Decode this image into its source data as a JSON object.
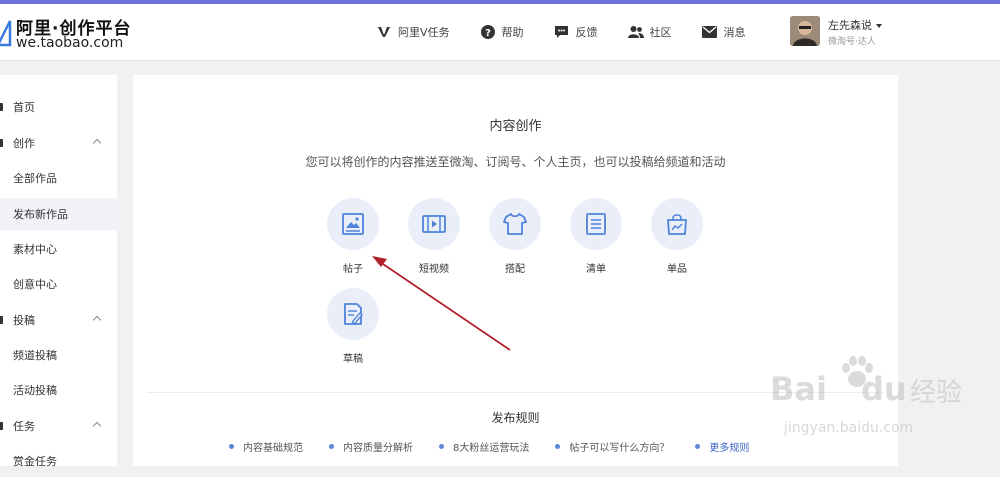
{
  "header": {
    "logo_title": "阿里·创作平台",
    "logo_subtitle": "we.taobao.com",
    "nav": [
      {
        "label": "阿里V任务",
        "icon": "v-icon"
      },
      {
        "label": "帮助",
        "icon": "help-icon"
      },
      {
        "label": "反馈",
        "icon": "feedback-icon"
      },
      {
        "label": "社区",
        "icon": "community-icon"
      },
      {
        "label": "消息",
        "icon": "mail-icon"
      }
    ],
    "user": {
      "name": "左先森说",
      "role": "微淘号·达人"
    }
  },
  "sidebar": {
    "items": [
      {
        "label": "首页"
      },
      {
        "label": "创作"
      },
      {
        "label": "全部作品"
      },
      {
        "label": "发布新作品"
      },
      {
        "label": "素材中心"
      },
      {
        "label": "创意中心"
      },
      {
        "label": "投稿"
      },
      {
        "label": "频道投稿"
      },
      {
        "label": "活动投稿"
      },
      {
        "label": "任务"
      },
      {
        "label": "赏金任务"
      }
    ]
  },
  "main": {
    "title": "内容创作",
    "description": "您可以将创作的内容推送至微淘、订阅号、个人主页，也可以投稿给频道和活动",
    "tiles": [
      {
        "label": "帖子",
        "icon": "post-image-icon"
      },
      {
        "label": "短视频",
        "icon": "video-icon"
      },
      {
        "label": "搭配",
        "icon": "outfit-icon"
      },
      {
        "label": "清单",
        "icon": "list-icon"
      },
      {
        "label": "单品",
        "icon": "product-bag-icon"
      },
      {
        "label": "草稿",
        "icon": "draft-icon"
      }
    ],
    "rules_title": "发布规则",
    "rules": [
      "内容基础规范",
      "内容质量分解析",
      "8大粉丝运营玩法",
      "帖子可以写什么方向？",
      "更多规则"
    ]
  },
  "watermark": {
    "brand": "Bai",
    "brand2": "du",
    "text": "经验",
    "url": "jingyan.baidu.com"
  },
  "colors": {
    "accent_stripe": "#6e6ed8",
    "tile_bg": "#e9eef8",
    "tile_icon": "#4f84d8",
    "arrow": "#b01e2a",
    "link": "#3a62c4"
  }
}
